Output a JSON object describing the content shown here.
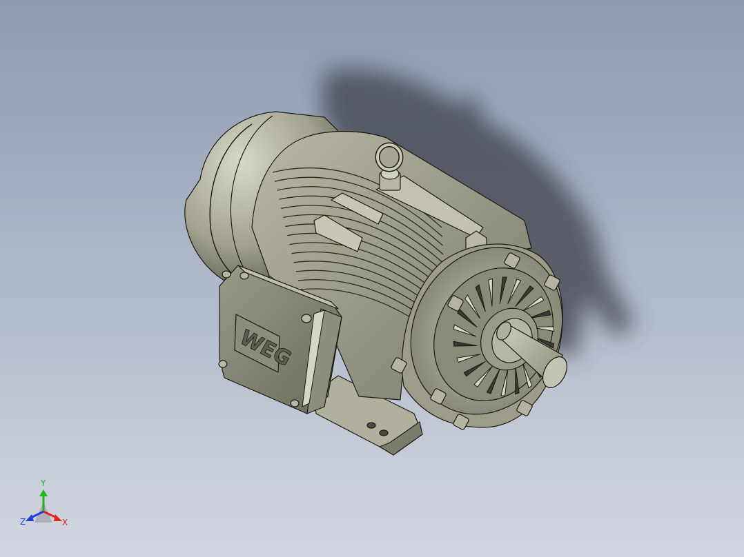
{
  "viewport": {
    "background_top": "#8b9bb1",
    "background_bottom": "#d2d6e0"
  },
  "model": {
    "body_color": "#a9a995",
    "dark_color": "#6e6e60",
    "light_color": "#d6d6c6",
    "outline_color": "#1a1a14",
    "shadow_color": "#3c4048",
    "logo_text": "WEG"
  },
  "triad": {
    "x_label": "X",
    "y_label": "Y",
    "z_label": "Z",
    "x_color": "#e0261c",
    "y_color": "#1fb51f",
    "z_color": "#1f3fd6"
  }
}
